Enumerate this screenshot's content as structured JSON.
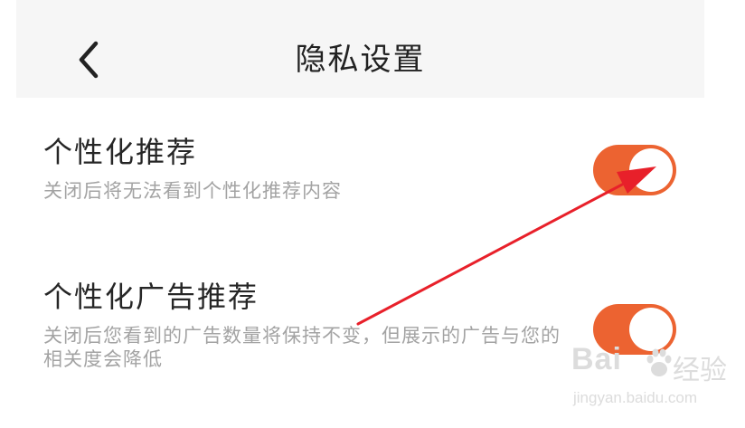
{
  "header": {
    "back_icon": "chevron-left-icon",
    "title": "隐私设置"
  },
  "settings": [
    {
      "title": "个性化推荐",
      "description": "关闭后将无法看到个性化推荐内容",
      "enabled": true
    },
    {
      "title": "个性化广告推荐",
      "description": "关闭后您看到的广告数量将保持不变，但展示的广告与您的相关度会降低",
      "enabled": true
    }
  ],
  "watermark": {
    "brand": "Bai",
    "brand_suffix": "经验",
    "url": "jingyan.baidu.com"
  },
  "colors": {
    "toggle_on": "#ec6331",
    "annotation_arrow": "#e8202a",
    "header_bg": "#f6f6f6"
  }
}
